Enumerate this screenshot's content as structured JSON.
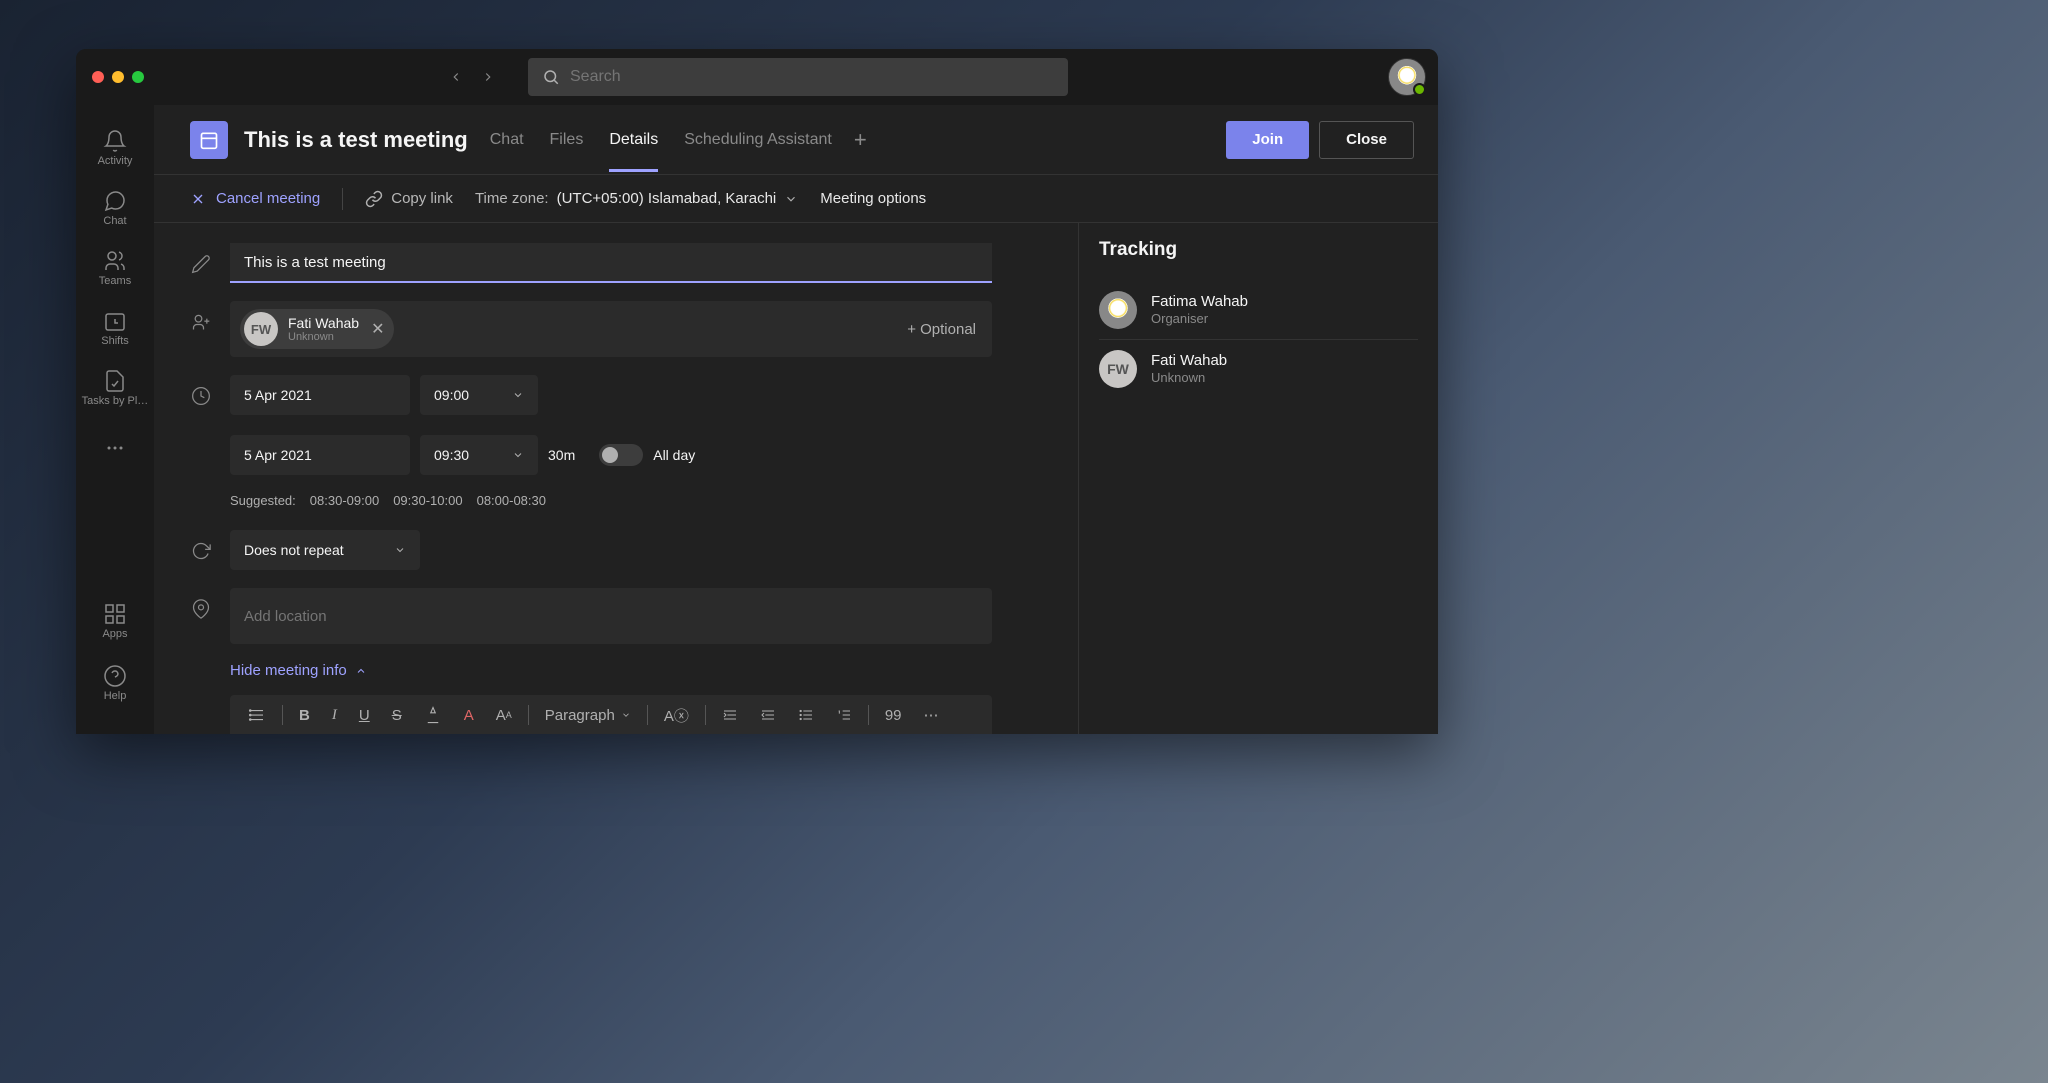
{
  "titlebar": {
    "search_placeholder": "Search"
  },
  "sidebar": {
    "activity": "Activity",
    "chat": "Chat",
    "teams": "Teams",
    "shifts": "Shifts",
    "tasks": "Tasks by Pl…",
    "more": "…",
    "apps": "Apps",
    "help": "Help"
  },
  "header": {
    "meeting_title": "This is a test meeting",
    "tabs": {
      "chat": "Chat",
      "files": "Files",
      "details": "Details",
      "scheduling": "Scheduling Assistant"
    },
    "join": "Join",
    "close": "Close"
  },
  "subheader": {
    "cancel": "Cancel meeting",
    "copy_link": "Copy link",
    "tz_label": "Time zone:",
    "tz_value": "(UTC+05:00) Islamabad, Karachi",
    "meeting_options": "Meeting options"
  },
  "form": {
    "title_value": "This is a test meeting",
    "attendee": {
      "initials": "FW",
      "name": "Fati Wahab",
      "sub": "Unknown"
    },
    "optional": "+ Optional",
    "start_date": "5 Apr 2021",
    "start_time": "09:00",
    "end_date": "5 Apr 2021",
    "end_time": "09:30",
    "duration": "30m",
    "all_day": "All day",
    "suggested_label": "Suggested:",
    "suggested_1": "08:30-09:00",
    "suggested_2": "09:30-10:00",
    "suggested_3": "08:00-08:30",
    "repeat": "Does not repeat",
    "location_placeholder": "Add location",
    "hide_info": "Hide meeting info",
    "toolbar": {
      "paragraph": "Paragraph",
      "quote": "99"
    }
  },
  "tracking": {
    "title": "Tracking",
    "organiser": {
      "name": "Fatima Wahab",
      "role": "Organiser"
    },
    "attendee": {
      "initials": "FW",
      "name": "Fati Wahab",
      "role": "Unknown"
    }
  }
}
